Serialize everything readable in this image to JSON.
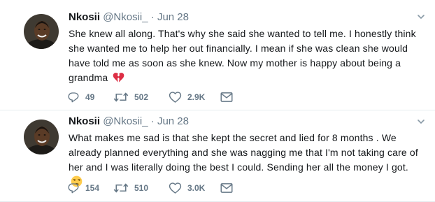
{
  "tweets": [
    {
      "name": "Nkosii",
      "handle": "@Nkosii_",
      "separator": "·",
      "time": "Jun 28",
      "text": "She knew all along. That's why she said she wanted to tell me. I honestly think she wanted me to help her out financially. I mean if she was clean she would have told me as soon as she knew. Now my mother is happy about being a grandma",
      "emoji": "broken-heart",
      "replies": "49",
      "retweets": "502",
      "likes": "2.9K"
    },
    {
      "name": "Nkosii",
      "handle": "@Nkosii_",
      "separator": "·",
      "time": "Jun 28",
      "text": "What makes me sad is that she kept the secret and lied for 8 months . We already planned everything and she was nagging me that I'm not taking care of her and I was literally doing the best I could. Sending her all the money I got.",
      "emoji": "unamused-face",
      "replies": "154",
      "retweets": "510",
      "likes": "3.0K"
    }
  ],
  "colors": {
    "text": "#14171a",
    "secondary": "#657786",
    "divider": "#e6ecf0",
    "broken_heart": "#dd2e44"
  }
}
